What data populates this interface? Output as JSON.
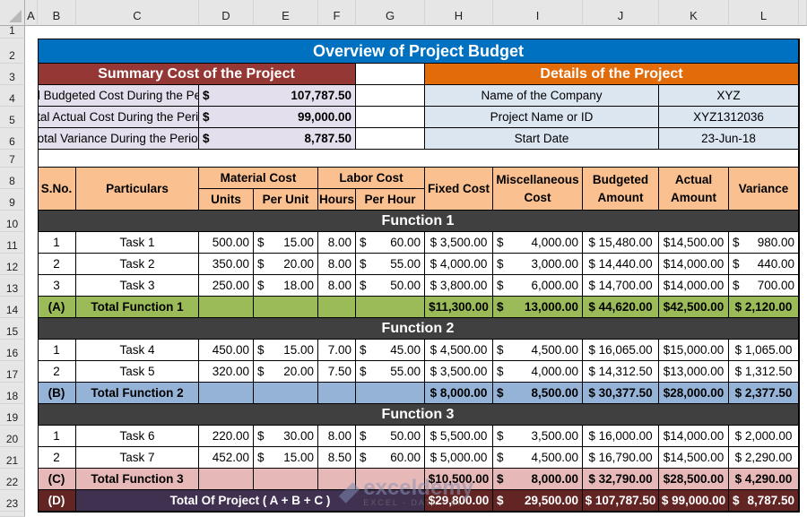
{
  "sheet": {
    "columns": [
      "A",
      "B",
      "C",
      "D",
      "E",
      "F",
      "G",
      "H",
      "I",
      "J",
      "K",
      "L"
    ],
    "rows": [
      "1",
      "2",
      "3",
      "4",
      "5",
      "6",
      "7",
      "8",
      "9",
      "10",
      "11",
      "12",
      "13",
      "14",
      "15",
      "16",
      "17",
      "18",
      "19",
      "20",
      "21",
      "22",
      "23"
    ]
  },
  "title": "Overview of Project Budget",
  "summary": {
    "header": "Summary Cost of the Project",
    "currency": "$",
    "items": [
      {
        "label": "Total Budgeted Cost During the Period",
        "value": "107,787.50"
      },
      {
        "label": "Total Actual Cost During the Period",
        "value": "99,000.00"
      },
      {
        "label": "Total Variance During the Period",
        "value": "8,787.50"
      }
    ]
  },
  "details": {
    "header": "Details of the Project",
    "items": [
      {
        "label": "Name of the Company",
        "value": "XYZ"
      },
      {
        "label": "Project Name or ID",
        "value": "XYZ1312036"
      },
      {
        "label": "Start Date",
        "value": "23-Jun-18"
      }
    ]
  },
  "table": {
    "headers": {
      "sno": "S.No.",
      "particulars": "Particulars",
      "material_cost": "Material Cost",
      "units": "Units",
      "per_unit": "Per Unit",
      "labor_cost": "Labor Cost",
      "hours": "Hours",
      "per_hour": "Per Hour",
      "fixed_cost": "Fixed Cost",
      "misc_cost": "Miscellaneous Cost",
      "budgeted": "Budgeted Amount",
      "actual": "Actual Amount",
      "variance": "Variance"
    },
    "dollar": "$",
    "functions": [
      {
        "title": "Function 1",
        "tasks": [
          {
            "sno": "1",
            "name": "Task 1",
            "units": "500.00",
            "per_unit": "15.00",
            "hours": "8.00",
            "per_hour": "60.00",
            "fixed": "$ 3,500.00",
            "misc": "4,000.00",
            "budgeted": "$ 15,480.00",
            "actual": "$14,500.00",
            "variance": "980.00"
          },
          {
            "sno": "2",
            "name": "Task 2",
            "units": "350.00",
            "per_unit": "20.00",
            "hours": "8.00",
            "per_hour": "55.00",
            "fixed": "$ 4,000.00",
            "misc": "3,000.00",
            "budgeted": "$ 14,440.00",
            "actual": "$14,000.00",
            "variance": "440.00"
          },
          {
            "sno": "3",
            "name": "Task 3",
            "units": "250.00",
            "per_unit": "18.00",
            "hours": "8.00",
            "per_hour": "50.00",
            "fixed": "$ 3,800.00",
            "misc": "6,000.00",
            "budgeted": "$ 14,700.00",
            "actual": "$14,000.00",
            "variance": "700.00"
          }
        ],
        "total": {
          "sno": "(A)",
          "label": "Total Function 1",
          "fixed": "$11,300.00",
          "misc": "13,000.00",
          "budgeted": "$ 44,620.00",
          "actual": "$42,500.00",
          "variance": "$ 2,120.00"
        }
      },
      {
        "title": "Function 2",
        "tasks": [
          {
            "sno": "1",
            "name": "Task 4",
            "units": "450.00",
            "per_unit": "15.00",
            "hours": "7.00",
            "per_hour": "45.00",
            "fixed": "$ 4,500.00",
            "misc": "4,500.00",
            "budgeted": "$ 16,065.00",
            "actual": "$15,000.00",
            "variance": "$ 1,065.00"
          },
          {
            "sno": "2",
            "name": "Task 5",
            "units": "320.00",
            "per_unit": "20.00",
            "hours": "7.50",
            "per_hour": "55.00",
            "fixed": "$ 3,500.00",
            "misc": "4,000.00",
            "budgeted": "$ 14,312.50",
            "actual": "$13,000.00",
            "variance": "$ 1,312.50"
          }
        ],
        "total": {
          "sno": "(B)",
          "label": "Total Function 2",
          "fixed": "$ 8,000.00",
          "misc": "8,500.00",
          "budgeted": "$ 30,377.50",
          "actual": "$28,000.00",
          "variance": "$ 2,377.50"
        }
      },
      {
        "title": "Function 3",
        "tasks": [
          {
            "sno": "1",
            "name": "Task 6",
            "units": "220.00",
            "per_unit": "30.00",
            "hours": "8.00",
            "per_hour": "50.00",
            "fixed": "$ 5,500.00",
            "misc": "3,500.00",
            "budgeted": "$ 16,000.00",
            "actual": "$14,000.00",
            "variance": "$ 2,000.00"
          },
          {
            "sno": "2",
            "name": "Task 7",
            "units": "452.00",
            "per_unit": "15.00",
            "hours": "8.50",
            "per_hour": "60.00",
            "fixed": "$ 5,000.00",
            "misc": "4,500.00",
            "budgeted": "$ 16,790.00",
            "actual": "$14,500.00",
            "variance": "$ 2,290.00"
          }
        ],
        "total": {
          "sno": "(C)",
          "label": "Total Function 3",
          "fixed": "$10,500.00",
          "misc": "8,000.00",
          "budgeted": "$ 32,790.00",
          "actual": "$28,500.00",
          "variance": "$ 4,290.00"
        }
      }
    ],
    "grand_total": {
      "sno": "(D)",
      "label": "Total Of Project ( A + B + C )",
      "fixed": "$29,800.00",
      "misc": "29,500.00",
      "budgeted": "$ 107,787.50",
      "actual": "$ 99,000.00",
      "variance": "8,787.50"
    }
  },
  "watermark": {
    "brand": "exceldemy",
    "tagline": "EXCEL - DATA - BI"
  },
  "colors": {
    "title": "#0070c0",
    "summary_header": "#953735",
    "details_header": "#e26b0a",
    "table_header": "#fac090",
    "function_header": "#404040",
    "total_a": "#9bbb59",
    "total_b": "#95b3d7",
    "total_c": "#e6b8b7",
    "total_d": "#632523"
  }
}
